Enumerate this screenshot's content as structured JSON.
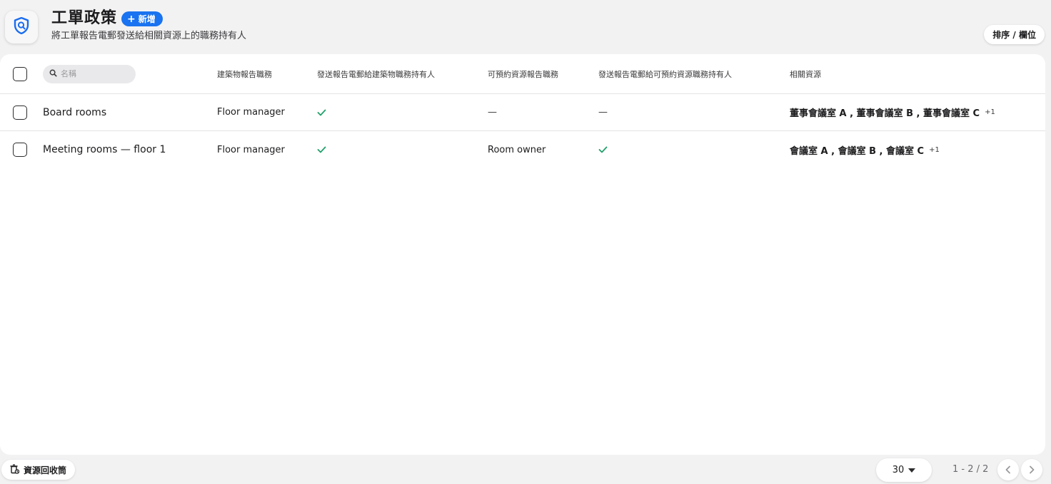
{
  "header": {
    "title": "工單政策",
    "add_label": "新增",
    "subtitle": "將工單報告電郵發送給相關資源上的職務持有人",
    "sort_label": "排序 / 欄位"
  },
  "table": {
    "search_placeholder": "名稱",
    "columns": {
      "building_role": "建築物報告職務",
      "send_building": "發送報告電郵給建築物職務持有人",
      "resource_role": "可預約資源報告職務",
      "send_resource": "發送報告電郵給可預約資源職務持有人",
      "related": "相關資源"
    },
    "rows": [
      {
        "name": "Board rooms",
        "building_role": "Floor manager",
        "send_building": "✓",
        "resource_role": "—",
        "send_resource": "—",
        "related": "董事會議室 A , 董事會議室 B , 董事會議室 C",
        "more": "+1"
      },
      {
        "name": "Meeting rooms — floor 1",
        "building_role": "Floor manager",
        "send_building": "✓",
        "resource_role": "Room owner",
        "send_resource": "✓",
        "related": "會議室 A , 會議室 B , 會議室 C",
        "more": "+1"
      }
    ]
  },
  "footer": {
    "trash_label": "資源回收筒",
    "page_size": "30",
    "page_range": "1 - 2 / 2"
  },
  "colors": {
    "accent": "#1a73f0",
    "check": "#22a06b",
    "icon_blue": "#1a6cf0"
  },
  "icons": {
    "app": "shield-search-icon",
    "add": "plus-icon",
    "search": "search-icon",
    "trash": "trash-restore-icon",
    "prev": "chevron-left-icon",
    "next": "chevron-right-icon"
  }
}
